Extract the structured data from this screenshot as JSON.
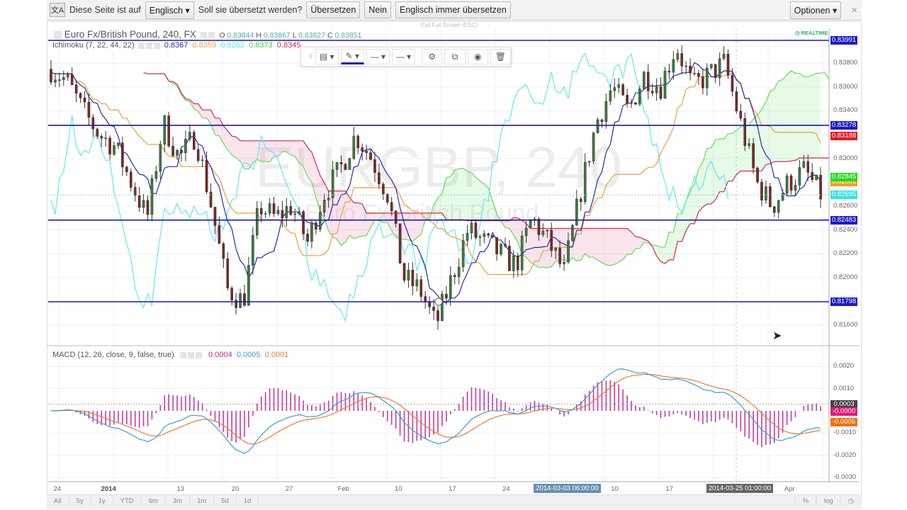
{
  "translate_bar": {
    "prefix": "Diese Seite ist auf",
    "language": "Englisch",
    "question": "Soll sie übersetzt werden?",
    "translate": "Übersetzen",
    "no": "Nein",
    "always": "Englisch immer übersetzen",
    "options": "Optionen",
    "close": "×"
  },
  "chart": {
    "symbol_title": "Euro Fx/British Pound, 240, FX",
    "ohlc": {
      "o_label": "O",
      "o": "0.83844",
      "h_label": "H",
      "h": "0.83867",
      "l_label": "L",
      "l": "0.83827",
      "c_label": "C",
      "c": "0.83851"
    },
    "exit_fullscreen": "Exit Full Screen (ESC)",
    "realtime": "REALTIME",
    "watermark": "EURGBP, 240",
    "watermark_sub": "Euro Fx/British Pound",
    "ichimoku": {
      "label": "Ichimoku (7, 22, 44, 22)",
      "values": [
        "0.8367",
        "0.8359",
        "0.8262",
        "0.8373",
        "0.8345"
      ]
    },
    "macd": {
      "label": "MACD (12, 26, close, 9, false, true)",
      "values": [
        "0.0004",
        "0.0005",
        "0.0001"
      ]
    },
    "price_ticks": [
      "0.83800",
      "0.83600",
      "0.83400",
      "0.83000",
      "0.82600",
      "0.82400",
      "0.82200",
      "0.82000",
      "0.81600"
    ],
    "price_tick_values": [
      0.838,
      0.836,
      0.834,
      0.83,
      0.826,
      0.824,
      0.822,
      0.82,
      0.816
    ],
    "level_lines": [
      {
        "value": 0.83991,
        "label": "0.83991"
      },
      {
        "value": 0.83278,
        "label": "0.83278"
      },
      {
        "value": 0.82483,
        "label": "0.82483"
      },
      {
        "value": 0.81798,
        "label": "0.81798"
      }
    ],
    "price_tags": [
      {
        "value": 0.83188,
        "label": "0.83188",
        "color": "#e01b24"
      },
      {
        "value": 0.82801,
        "label": "0.82801",
        "color": "#f0a020"
      },
      {
        "value": 0.82845,
        "label": "0.82845",
        "color": "#22dd22"
      },
      {
        "value": 0.82695,
        "label": "0.82695",
        "color": "#33e6e6"
      }
    ],
    "macd_ticks": [
      "0.0020",
      "0.0010",
      "-0.0010",
      "-0.0020",
      "-0.0030"
    ],
    "macd_tick_values": [
      0.002,
      0.001,
      -0.001,
      -0.002,
      -0.003
    ],
    "macd_tags": [
      {
        "value": 0.0003,
        "label": "0.0003",
        "color": "#444"
      },
      {
        "value": -3e-05,
        "label": "-0.0000",
        "color": "#e0197d"
      },
      {
        "value": -0.0005,
        "label": "-0.0005",
        "color": "#f07010"
      }
    ],
    "time_labels": [
      {
        "label": "24",
        "pos": 0.014
      },
      {
        "label": "2014",
        "pos": 0.075
      },
      {
        "label": "13",
        "pos": 0.172
      },
      {
        "label": "20",
        "pos": 0.242
      },
      {
        "label": "27",
        "pos": 0.311
      },
      {
        "label": "Feb",
        "pos": 0.378
      },
      {
        "label": "10",
        "pos": 0.451
      },
      {
        "label": "17",
        "pos": 0.52
      },
      {
        "label": "24",
        "pos": 0.589
      },
      {
        "label": "10",
        "pos": 0.728
      },
      {
        "label": "17",
        "pos": 0.798
      },
      {
        "label": "Apr",
        "pos": 0.95
      }
    ],
    "crosshair_times": [
      {
        "label": "2014-03-03 06:00:00",
        "pos": 0.66
      },
      {
        "label": "2014-03-25 01:00:00",
        "pos": 0.881
      }
    ],
    "ranges": [
      "All",
      "5y",
      "1y",
      "YTD",
      "6m",
      "3m",
      "1m",
      "5d",
      "1d"
    ],
    "bottom_right": [
      "%",
      "log"
    ],
    "colors": {
      "tenkan": "#2a2aa8",
      "kijun": "#e8a040",
      "chikou": "#66e6f0",
      "spanA": "#66dd55",
      "spanB": "#c83050",
      "level": "#1a1aa8",
      "up": "#3d7a3d",
      "down": "#7a2a2a",
      "hist": "#c43aa0",
      "macd": "#3aa0d0",
      "signal": "#f07a30"
    }
  },
  "chart_data": {
    "type": "candlestick",
    "price_path": [
      0.8375,
      0.8365,
      0.834,
      0.832,
      0.831,
      0.828,
      0.825,
      0.833,
      0.83,
      0.832,
      0.826,
      0.819,
      0.818,
      0.826,
      0.825,
      0.826,
      0.823,
      0.827,
      0.829,
      0.832,
      0.83,
      0.827,
      0.82,
      0.819,
      0.816,
      0.82,
      0.824,
      0.823,
      0.822,
      0.821,
      0.825,
      0.823,
      0.8205,
      0.827,
      0.833,
      0.836,
      0.834,
      0.837,
      0.836,
      0.8395,
      0.836,
      0.837,
      0.838,
      0.833,
      0.828,
      0.826,
      0.828,
      0.829,
      0.827
    ],
    "ylim": [
      0.8155,
      0.8408
    ]
  }
}
